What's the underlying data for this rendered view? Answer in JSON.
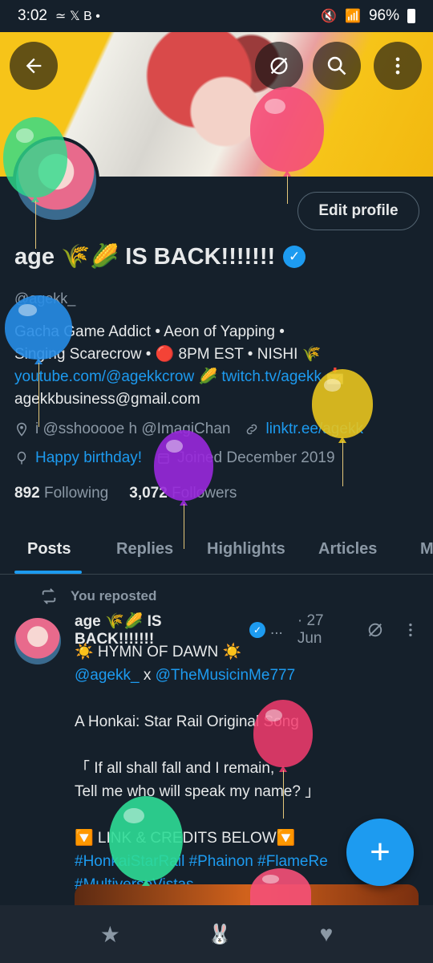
{
  "status_bar": {
    "time": "3:02",
    "left_icons": "≃ 𝕏 B •",
    "battery": "96%"
  },
  "header": {
    "back_icon": "arrow-left-icon",
    "edit_image_icon": "no-image-icon",
    "search_icon": "search-icon",
    "menu_icon": "more-vertical-icon"
  },
  "profile": {
    "display_name": "age 🌾🌽 IS BACK!!!!!!!",
    "handle": "@agekk_",
    "edit_button": "Edit profile",
    "bio_line1": "Gacha Game Addict • Aeon of Yapping •",
    "bio_line2": "Singing Scarecrow • 🔴 8PM EST • NISHI 🌾",
    "bio_link1": "youtube.com/@agekkcrow",
    "bio_mid": " 🌽 ",
    "bio_link2": "twitch.tv/agekk",
    "bio_tail": " 📩",
    "bio_email": "agekkbusiness@gmail.com",
    "location": "i @sshooooe h @ImagiChan",
    "website": "linktr.ee/agekk",
    "birthday": "Happy birthday!",
    "joined": "Joined December 2019",
    "following_count": "892",
    "following_label": "Following",
    "followers_count": "3,072",
    "followers_label": "Followers"
  },
  "tabs": [
    "Posts",
    "Replies",
    "Highlights",
    "Articles",
    "M"
  ],
  "post": {
    "repost_label": "You reposted",
    "author": "age 🌾🌽 IS BACK!!!!!!!",
    "ellipsis": "...",
    "date": "· 27 Jun",
    "line1": "☀️ HYMN OF DAWN ☀️",
    "mention1": "@agekk_",
    "x_sep": " x ",
    "mention2": "@TheMusicinMe777",
    "line3": "A Honkai: Star Rail Original Song",
    "line4": "「 If all shall fall and I remain,",
    "line5": "Tell me who will speak my name? 」",
    "line6": "🔽 LINK & CREDITS BELOW🔽",
    "hashtags1": "#HonkaiStarRail #Phainon #FlameRe",
    "hashtags2": "#MultiverseVistas"
  },
  "fab_label": "+",
  "bottom_nav": [
    "star-icon",
    "rabbit-icon",
    "heart-icon"
  ],
  "colors": {
    "background": "#15202b",
    "accent": "#1d9bf0",
    "muted": "#8b98a5"
  }
}
